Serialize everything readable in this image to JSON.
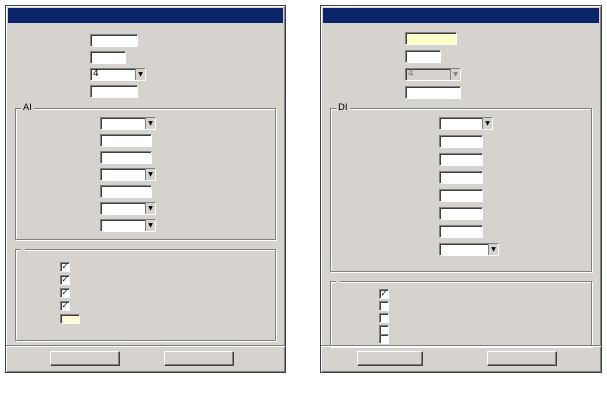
{
  "ai_dialog": {
    "title": "",
    "fields": [
      {
        "label": "",
        "value": ""
      },
      {
        "label": "",
        "value": ""
      },
      {
        "label": "",
        "value": "4"
      },
      {
        "label": "",
        "value": ""
      }
    ],
    "ai_group": {
      "title": "AI",
      "fields": [
        {
          "label": "",
          "value": ""
        },
        {
          "label": "",
          "value": ""
        },
        {
          "label": "",
          "value": ""
        },
        {
          "label": "",
          "value": ""
        },
        {
          "label": "",
          "value": ""
        },
        {
          "label": "",
          "value": ""
        },
        {
          "label": "",
          "value": ""
        }
      ]
    },
    "stats_group": {
      "title": "",
      "items": [
        {
          "label": "",
          "checked": true,
          "mark": "✓"
        },
        {
          "label": "",
          "checked": true,
          "mark": "✓"
        },
        {
          "label": "",
          "checked": true,
          "mark": "✓"
        },
        {
          "label": "",
          "checked": true,
          "mark": "✓"
        },
        {
          "label": "",
          "checked": false,
          "mark": ""
        }
      ]
    },
    "buttons": {
      "ok": "",
      "close": ""
    }
  },
  "di_dialog": {
    "title": "",
    "fields": [
      {
        "label": "",
        "value": ""
      },
      {
        "label": "",
        "value": ""
      },
      {
        "label": "",
        "value": "4"
      },
      {
        "label": "",
        "value": ""
      }
    ],
    "di_group": {
      "title": "DI",
      "fields": [
        {
          "label": "",
          "value": ""
        },
        {
          "label": "",
          "value": ""
        },
        {
          "label": "",
          "value": ""
        },
        {
          "label": "",
          "value": ""
        },
        {
          "label": "",
          "value": ""
        },
        {
          "label": "",
          "value": ""
        },
        {
          "label": "",
          "value": ""
        },
        {
          "label": "",
          "value": ""
        }
      ]
    },
    "stats_group": {
      "title": "",
      "items": [
        {
          "label": "",
          "checked": true,
          "mark": "✓"
        },
        {
          "label": "",
          "checked": false,
          "mark": ""
        },
        {
          "label": "",
          "checked": false,
          "mark": ""
        },
        {
          "label": "",
          "checked": false,
          "mark": ""
        },
        {
          "label": "",
          "checked": false,
          "mark": ""
        }
      ]
    },
    "buttons": {
      "ok": "",
      "close": ""
    }
  },
  "captions": {
    "figure_6": "",
    "figure_7": ""
  },
  "colors": {
    "dialog_face": "#d6d3ce",
    "titlebar": "#0a246a",
    "highlight_field": "#ffffc8",
    "highlight_checkbox": "#fff8d0"
  }
}
